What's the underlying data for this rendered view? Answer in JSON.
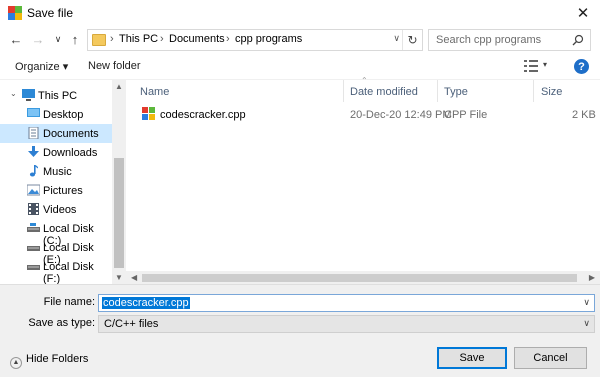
{
  "window": {
    "title": "Save file",
    "close_label": "✕"
  },
  "nav": {
    "back": "←",
    "forward": "→",
    "recent": "∨",
    "up": "↑"
  },
  "address": {
    "crumbs": [
      "This PC",
      "Documents",
      "cpp programs"
    ],
    "dropdown": "∨",
    "refresh": "↻"
  },
  "search": {
    "placeholder": "Search cpp programs",
    "icon": "search-icon"
  },
  "toolbar": {
    "organize": "Organize ▾",
    "new_folder": "New folder",
    "view_dropdown": "▾",
    "help": "?"
  },
  "sidebar": {
    "items": [
      {
        "label": "This PC",
        "icon": "pc-icon"
      },
      {
        "label": "Desktop",
        "icon": "desktop-icon"
      },
      {
        "label": "Documents",
        "icon": "documents-icon",
        "selected": true
      },
      {
        "label": "Downloads",
        "icon": "downloads-icon"
      },
      {
        "label": "Music",
        "icon": "music-icon"
      },
      {
        "label": "Pictures",
        "icon": "pictures-icon"
      },
      {
        "label": "Videos",
        "icon": "videos-icon"
      },
      {
        "label": "Local Disk (C:)",
        "icon": "disk-icon"
      },
      {
        "label": "Local Disk (E:)",
        "icon": "disk-icon"
      },
      {
        "label": "Local Disk (F:)",
        "icon": "disk-icon"
      }
    ]
  },
  "columns": [
    "Name",
    "Date modified",
    "Type",
    "Size"
  ],
  "files": [
    {
      "name": "codescracker.cpp",
      "date": "20-Dec-20 12:49 PM",
      "type": "CPP File",
      "size": "2 KB"
    }
  ],
  "form": {
    "file_name_label": "File name:",
    "file_name_value": "codescracker.cpp",
    "save_type_label": "Save as type:",
    "save_type_value": "C/C++ files"
  },
  "footer": {
    "hide_folders": "Hide Folders",
    "save": "Save",
    "cancel": "Cancel"
  },
  "colors": {
    "accent": "#0078d7",
    "selection": "#cce8ff",
    "help": "#1e6ec8"
  }
}
